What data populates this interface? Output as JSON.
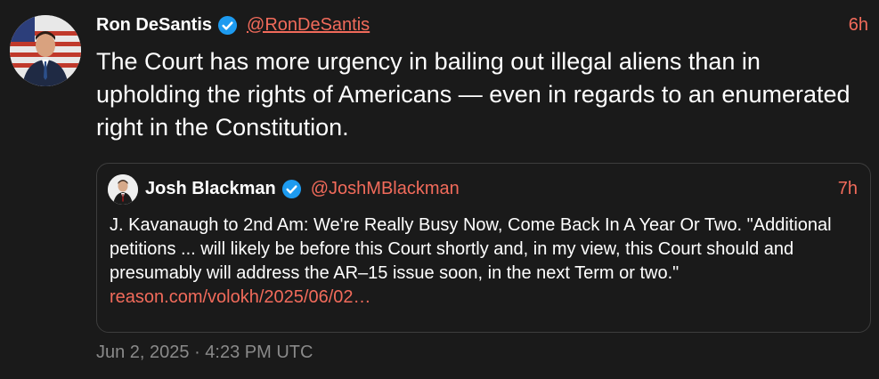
{
  "tweet": {
    "author_name": "Ron DeSantis",
    "author_handle": "@RonDeSantis",
    "time": "6h",
    "text": "The Court has more urgency in bailing out illegal aliens than in upholding the rights of Americans — even in regards to an enumerated right in the Constitution.",
    "timestamp": "Jun 2, 2025 · 4:23 PM UTC"
  },
  "quote": {
    "author_name": "Josh Blackman",
    "author_handle": "@JoshMBlackman",
    "time": "7h",
    "text": "J. Kavanaugh to 2nd Am: We're Really Busy Now, Come Back In A Year Or Two. \"Additional petitions ... will likely be before this Court shortly and, in my view, this Court should and presumably will address the AR–15 issue soon, in the next Term or two.\" ",
    "link": "reason.com/volokh/2025/06/02…"
  },
  "colors": {
    "accent": "#f26b5b",
    "verified": "#1d9bf0",
    "background": "#1a1a1a",
    "muted": "#8a8a8a",
    "border": "#3d3d3d"
  },
  "icons": {
    "verified": "verified-badge-icon"
  }
}
